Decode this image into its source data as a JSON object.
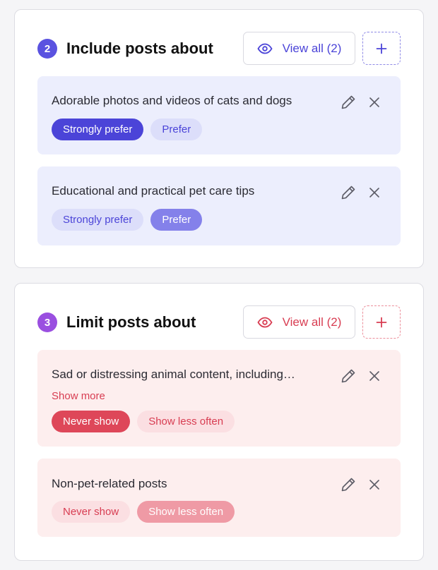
{
  "colors": {
    "include_accent": "#4b44d8",
    "include_bg": "#eceefd",
    "limit_accent": "#d83d52",
    "limit_bg": "#fdeeee"
  },
  "include": {
    "number": "2",
    "title": "Include posts about",
    "view_all_label": "View all (2)",
    "view_icon": "eye-icon",
    "add_icon": "plus-icon",
    "items": [
      {
        "text": "Adorable photos and videos of cats and dogs",
        "chips": [
          {
            "label": "Strongly prefer",
            "state": "selected"
          },
          {
            "label": "Prefer",
            "state": "unselected"
          }
        ]
      },
      {
        "text": "Educational and practical pet care tips",
        "chips": [
          {
            "label": "Strongly prefer",
            "state": "unselected"
          },
          {
            "label": "Prefer",
            "state": "selected"
          }
        ]
      }
    ]
  },
  "limit": {
    "number": "3",
    "title": "Limit posts about",
    "view_all_label": "View all (2)",
    "view_icon": "eye-icon",
    "add_icon": "plus-icon",
    "items": [
      {
        "text": "Sad or distressing animal content, including…",
        "show_more": "Show more",
        "chips": [
          {
            "label": "Never show",
            "state": "selected"
          },
          {
            "label": "Show less often",
            "state": "unselected"
          }
        ]
      },
      {
        "text": "Non-pet-related posts",
        "chips": [
          {
            "label": "Never show",
            "state": "unselected"
          },
          {
            "label": "Show less often",
            "state": "selected"
          }
        ]
      }
    ]
  }
}
